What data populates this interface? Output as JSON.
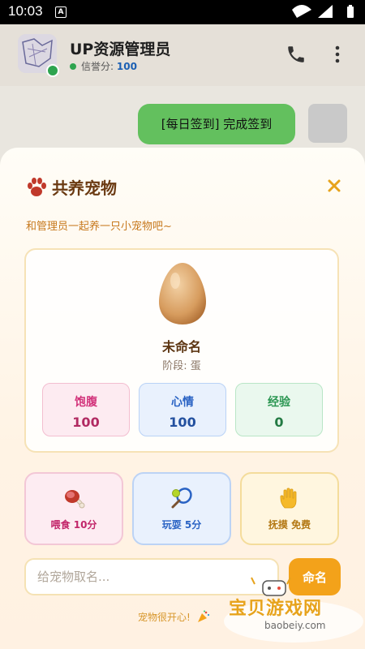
{
  "status_bar": {
    "time": "10:03",
    "notification_glyph": "A"
  },
  "chat_header": {
    "title": "UP资源管理员",
    "credit_label": "信誉分:",
    "credit_value": "100"
  },
  "chat": {
    "message": "[每日签到] 完成签到"
  },
  "pet_sheet": {
    "title": "共养宠物",
    "subtitle": "和管理员一起养一只小宠物吧~",
    "pet": {
      "name": "未命名",
      "stage": "阶段: 蛋"
    },
    "stats": [
      {
        "label": "饱腹",
        "value": "100"
      },
      {
        "label": "心情",
        "value": "100"
      },
      {
        "label": "经验",
        "value": "0"
      }
    ],
    "actions": [
      {
        "label": "喂食 10分",
        "icon": "meat-icon"
      },
      {
        "label": "玩耍 5分",
        "icon": "tennis-icon"
      },
      {
        "label": "抚摸 免费",
        "icon": "hand-icon"
      }
    ],
    "name_input": {
      "placeholder": "给宠物取名...",
      "value": ""
    },
    "name_button": "命名",
    "status_message": "宠物很开心!"
  },
  "watermark": {
    "text": "宝贝游戏网",
    "url": "baobeiy.com"
  },
  "colors": {
    "accent": "#f3a21a",
    "title_brown": "#6b3a12",
    "hunger": "#d2327a",
    "mood": "#2a63c4",
    "exp": "#2b9652",
    "chat_bubble": "#63c05e"
  }
}
